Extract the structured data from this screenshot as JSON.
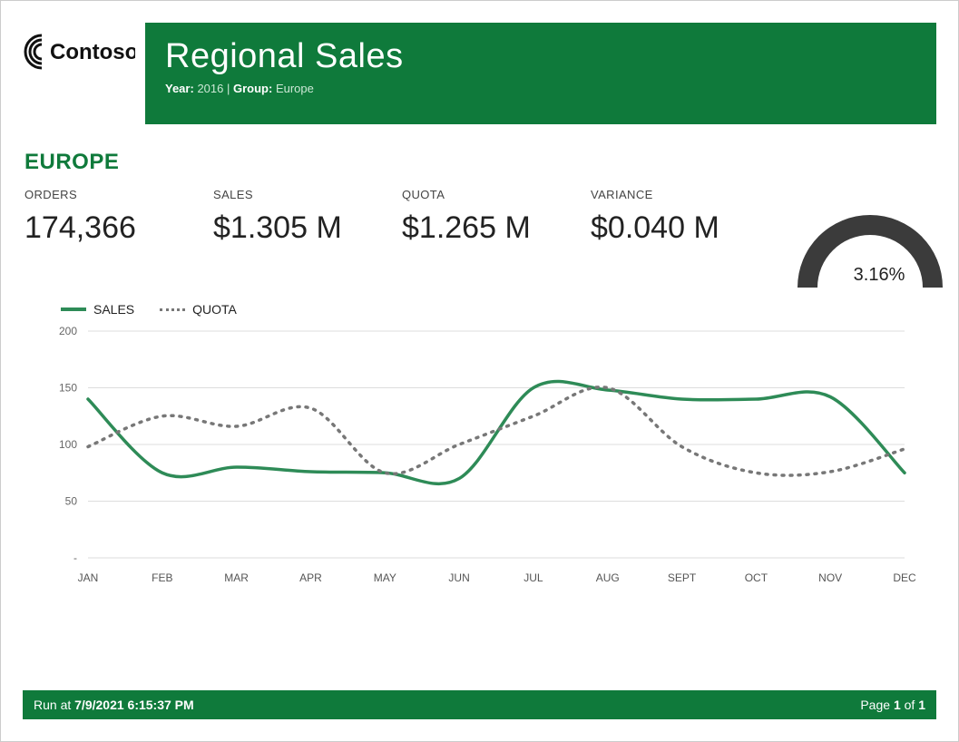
{
  "brand": "Contoso",
  "header": {
    "title": "Regional Sales",
    "year_label": "Year:",
    "year_value": "2016",
    "group_label": "Group:",
    "group_value": "Europe"
  },
  "region_heading": "EUROPE",
  "kpis": {
    "orders_label": "ORDERS",
    "orders_value": "174,366",
    "sales_label": "SALES",
    "sales_value": "$1.305 M",
    "quota_label": "QUOTA",
    "quota_value": "$1.265 M",
    "variance_label": "VARIANCE",
    "variance_value": "$0.040 M"
  },
  "gauge": {
    "percent_text": "3.16%",
    "percent_value": 3.16
  },
  "legend": {
    "sales": "SALES",
    "quota": "QUOTA"
  },
  "footer": {
    "run_at_label": "Run at",
    "run_at_value": "7/9/2021 6:15:37 PM",
    "page_label": "Page",
    "page_current": "1",
    "page_of": "of",
    "page_total": "1"
  },
  "chart_data": {
    "type": "line",
    "title": "",
    "xlabel": "",
    "ylabel": "",
    "ylim": [
      0,
      200
    ],
    "y_ticks": [
      0,
      50,
      100,
      150,
      200
    ],
    "y_tick_labels": [
      "-",
      "50",
      "100",
      "150",
      "200"
    ],
    "categories": [
      "JAN",
      "FEB",
      "MAR",
      "APR",
      "MAY",
      "JUN",
      "JUL",
      "AUG",
      "SEPT",
      "OCT",
      "NOV",
      "DEC"
    ],
    "series": [
      {
        "name": "SALES",
        "style": "solid",
        "color": "#2e8b57",
        "values": [
          140,
          75,
          80,
          76,
          75,
          70,
          150,
          148,
          140,
          140,
          142,
          75
        ]
      },
      {
        "name": "QUOTA",
        "style": "dotted",
        "color": "#777777",
        "values": [
          98,
          125,
          116,
          132,
          75,
          100,
          125,
          150,
          98,
          75,
          76,
          96
        ]
      }
    ]
  },
  "colors": {
    "brand_green": "#0f7a3b",
    "series_green": "#2e8b57",
    "grey": "#777777",
    "gauge": "#3b3b3b"
  }
}
